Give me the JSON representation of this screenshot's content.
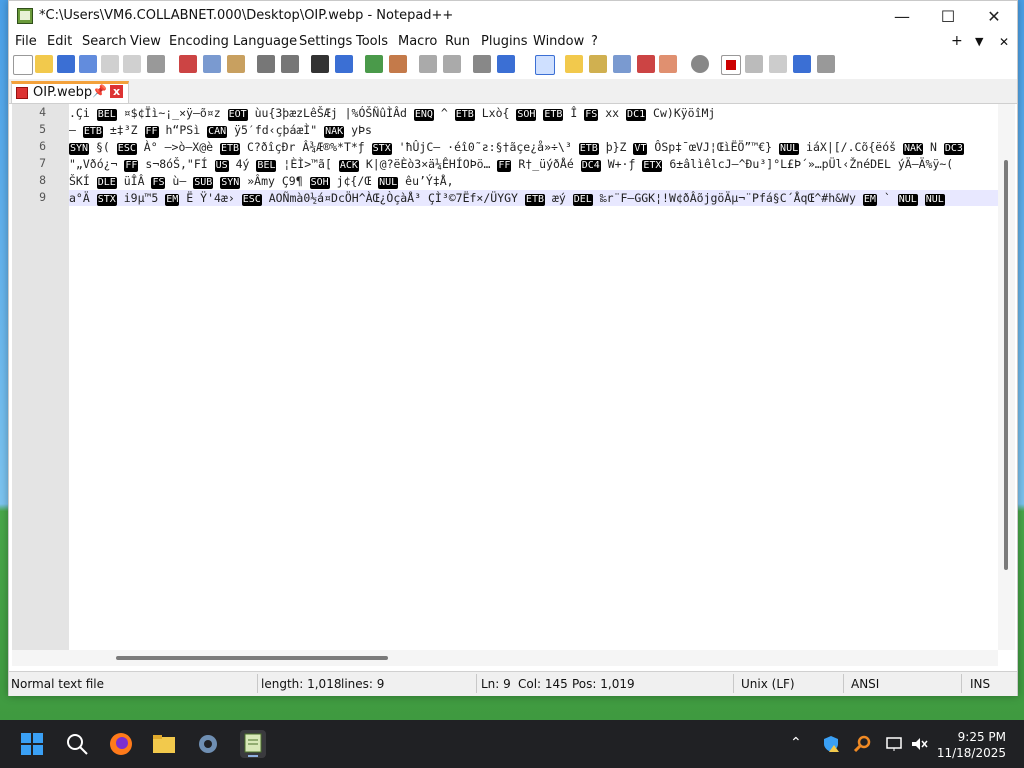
{
  "window": {
    "title": "*C:\\Users\\VM6.COLLABNET.000\\Desktop\\OIP.webp - Notepad++",
    "controls": {
      "minimize": "—",
      "maximize": "☐",
      "close": "✕"
    }
  },
  "menubar": {
    "items": [
      "File",
      "Edit",
      "Search",
      "View",
      "Encoding",
      "Language",
      "Settings",
      "Tools",
      "Macro",
      "Run",
      "Plugins",
      "Window",
      "?"
    ],
    "right": {
      "plus": "+",
      "dropdown": "▼",
      "close": "✕"
    }
  },
  "toolbar": {
    "icons": [
      "new-file-icon",
      "open-file-icon",
      "save-icon",
      "save-all-icon",
      "close-icon",
      "close-all-icon",
      "print-icon",
      "cut-icon",
      "copy-icon",
      "paste-icon",
      "undo-icon",
      "redo-icon",
      "find-icon",
      "replace-icon",
      "zoom-in-icon",
      "zoom-out-icon",
      "sync-v-icon",
      "sync-h-icon",
      "word-wrap-icon",
      "show-all-chars-icon",
      "indent-guide-icon",
      "doc-map-icon",
      "function-list-icon",
      "folder-workspace-icon",
      "monitoring-icon",
      "macro-record-icon",
      "macro-stop-icon",
      "macro-play-icon",
      "macro-run-multiple-icon",
      "macro-save-icon"
    ]
  },
  "tab": {
    "label": "OIP.webp",
    "pin": "📌",
    "close": "x"
  },
  "editor": {
    "lines": [
      {
        "num": "4",
        "text": ".Çi BEL ¤$¢Ïì~¡_×ÿ–õ¤z EOT ùu{3þæzLêŠÆj |%ÓŠÑûÌÂd ENQ ^ ETB Lxò{ SOH ETB Î FS xx DC1 Cw)KÿöîMj"
      },
      {
        "num": "5",
        "text": "– ETB ±‡³Z FF h“PSì CAN ÿ5′fd‹çþáæÌ\" NAK yÞs"
      },
      {
        "num": "6",
        "text": "SYN §( ESC À° –>ò–X@è ETB C?ðîçÐr Â¾Æ®%*T*ƒ STX 'ħÛjC– ·éî0˜ƨ:§†ãçe¿å»÷\\³ ETB þ}Z VT ÔSp‡¯œVJ¦ŒìËÖ”™€} NUL iáX|[/.Cõ{ëóš NAK N DC3"
      },
      {
        "num": "7",
        "text": "\"„Vðó¿¬ FF s¬8óŠ,\"FÍ US 4ý BEL ¦ÈÌ>™ã[ ACK K|@?ëÈò3×ä¼ÊHÍOÞö… FF R†_üýðÅé DC4 W+·ƒ ETX 6±âlìêlcJ–^Ðu³]°L£Þ´»…pÜl‹ŽnéDEL ýÄ–Ä%ÿ~("
      },
      {
        "num": "8",
        "text": "ŠKÍ DLE üÎÂ FS ù– SUB SYN »Âmy Ç9¶ SOH j¢{/Œ NUL êu’Ý‡Å,"
      },
      {
        "num": "9",
        "text": "a°Ä STX i9µ™5 EM Ë Ÿ'4æ› ESC AOÑmà0½á¤DcÖH^ÀŒ¿ÒçàÅ³ ÇÌ³©7Ëf×/ÜYGY ETB æý DEL ‰r¨F–GGK¦!W¢ðÂõjgöÄµ¬¨Pfá§C´ÅqŒ^#h&Wy EM ` NUL NUL"
      }
    ]
  },
  "statusbar": {
    "file_type": "Normal text file",
    "length": "length: 1,018",
    "lines": "lines: 9",
    "ln": "Ln: 9",
    "col": "Col: 145",
    "pos": "Pos: 1,019",
    "eol": "Unix (LF)",
    "encoding": "ANSI",
    "mode": "INS"
  },
  "taskbar": {
    "icons": [
      "start-icon",
      "search-icon",
      "firefox-icon",
      "file-explorer-icon",
      "settings-icon",
      "notepadpp-icon"
    ],
    "tray": {
      "chevron": "⌃"
    },
    "clock": {
      "time": "9:25 PM",
      "date": "11/18/2025"
    }
  }
}
